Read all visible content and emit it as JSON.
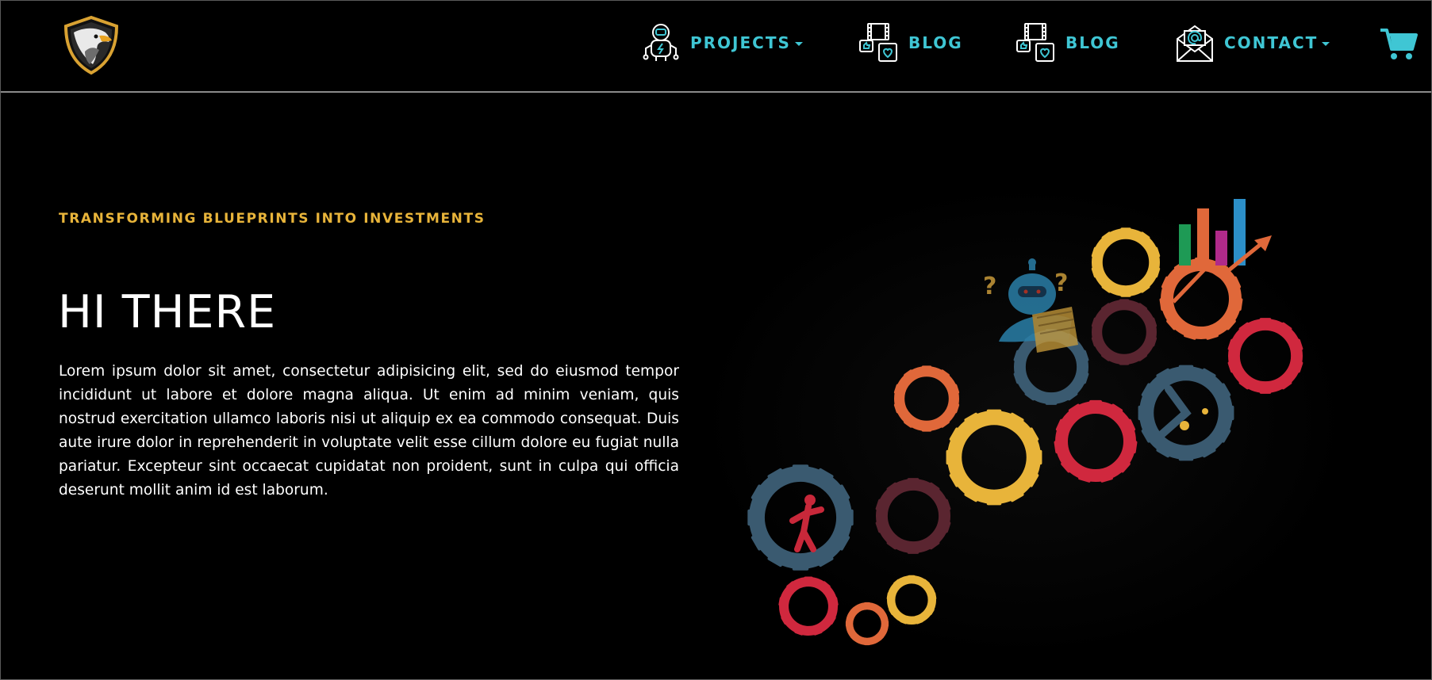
{
  "nav": {
    "items": [
      {
        "label": "PROJECTS",
        "icon": "robot-icon",
        "has_dropdown": true
      },
      {
        "label": "BLOG",
        "icon": "film-like-heart-icon",
        "has_dropdown": false
      },
      {
        "label": "BLOG",
        "icon": "film-like-heart-icon",
        "has_dropdown": false
      },
      {
        "label": "CONTACT",
        "icon": "envelope-at-icon",
        "has_dropdown": true
      }
    ],
    "cart_icon": "shopping-cart-icon",
    "logo_icon": "eagle-shield-logo"
  },
  "hero": {
    "tagline": "TRANSFORMING BLUEPRINTS INTO INVESTMENTS",
    "title": "HI THERE",
    "body": "Lorem ipsum dolor sit amet, consectetur adipisicing elit, sed do eiusmod tempor incididunt ut labore et dolore magna aliqua. Ut enim ad minim veniam, quis nostrud exercitation ullamco laboris nisi ut aliquip ex ea commodo consequat. Duis aute irure dolor in reprehenderit in voluptate velit esse cillum dolore eu fugiat nulla pariatur. Excepteur sint occaecat cupidatat non proident, sunt in culpa qui officia deserunt mollit anim id est laborum.",
    "illustration_icon": "gears-illustration"
  },
  "colors": {
    "accent": "#3fc6d4",
    "tagline": "#e8b43a",
    "background": "#000000",
    "gear_yellow": "#e8b43a",
    "gear_orange": "#e0683a",
    "gear_red": "#d0283e",
    "gear_slate": "#3a5a70",
    "gear_maroon": "#5a2530"
  }
}
